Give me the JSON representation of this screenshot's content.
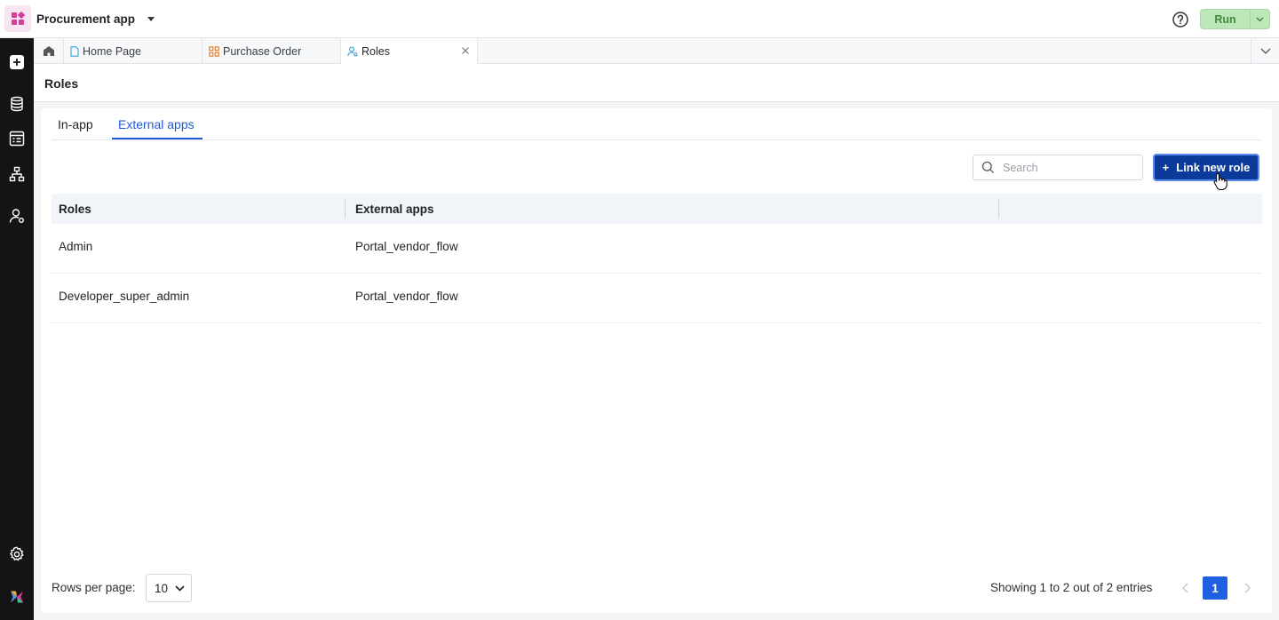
{
  "app": {
    "title": "Procurement app",
    "accent": "#d63d9b"
  },
  "topbar": {
    "run_label": "Run",
    "help_icon": "help-circle-icon"
  },
  "rail": {
    "icons": [
      "add-icon",
      "database-icon",
      "form-icon",
      "workflow-icon",
      "roles-icon",
      "settings-icon",
      "brand-logo-icon"
    ]
  },
  "tabs": [
    {
      "label": "Home Page",
      "icon": "page-icon"
    },
    {
      "label": "Purchase Order",
      "icon": "process-icon"
    },
    {
      "label": "Roles",
      "icon": "roles-icon",
      "active": true
    }
  ],
  "page": {
    "title": "Roles"
  },
  "subtabs": [
    {
      "label": "In-app"
    },
    {
      "label": "External apps",
      "active": true
    }
  ],
  "search": {
    "placeholder": "Search"
  },
  "actions": {
    "link_new_role": "Link new role",
    "plus": "+"
  },
  "table": {
    "headers": [
      "Roles",
      "External apps"
    ],
    "rows": [
      {
        "role": "Admin",
        "external_app": "Portal_vendor_flow"
      },
      {
        "role": "Developer_super_admin",
        "external_app": "Portal_vendor_flow"
      }
    ]
  },
  "footer": {
    "rows_per_page_label": "Rows per page:",
    "rows_per_page_value": "10",
    "showing_text": "Showing 1 to 2 out of 2 entries",
    "current_page": "1"
  },
  "colors": {
    "primary": "#0b3a9b",
    "tab_active": "#1d5bd6",
    "run_bg": "#bde6b9",
    "run_text": "#3f8a38"
  }
}
